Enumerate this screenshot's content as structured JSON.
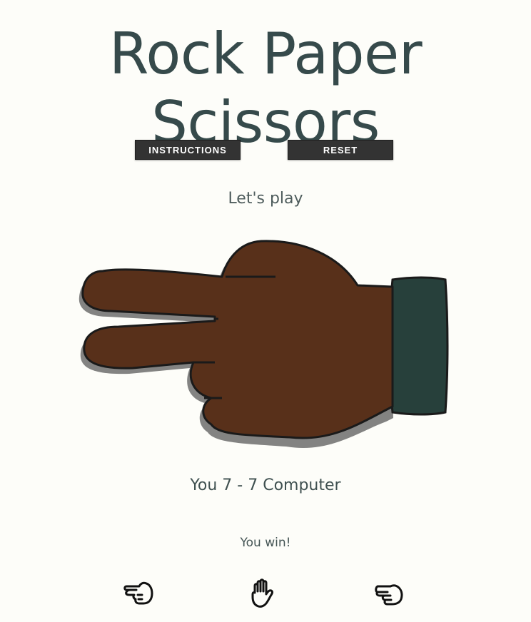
{
  "header": {
    "title": "Rock Paper Scissors"
  },
  "buttons": {
    "instructions_label": "INSTRUCTIONS",
    "reset_label": "RESET"
  },
  "game": {
    "status": "Let's play",
    "score_text": "You 7 - 7 Computer",
    "result_text": "You win!",
    "displayed_hand_icon": "scissors-hand-icon"
  },
  "choices": [
    {
      "icon": "scissors-icon"
    },
    {
      "icon": "paper-icon"
    },
    {
      "icon": "rock-icon"
    }
  ],
  "colors": {
    "background": "#fdfdf9",
    "title": "#364a4b",
    "button": "#333333",
    "skin": "#58301a",
    "sleeve": "#27403b",
    "outline": "#1a1a1a"
  }
}
